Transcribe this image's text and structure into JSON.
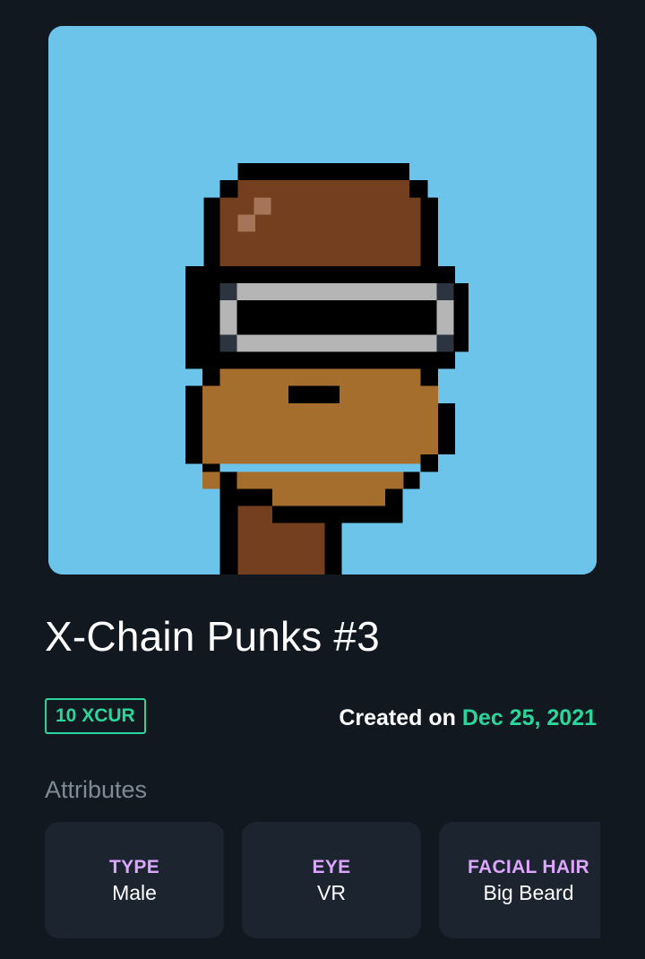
{
  "nft": {
    "title": "X-Chain Punks #3",
    "image_name": "pixel-punk-portrait"
  },
  "price": {
    "label": "10 XCUR"
  },
  "created": {
    "prefix": "Created on ",
    "date": "Dec 25, 2021"
  },
  "attributes": {
    "heading": "Attributes",
    "items": [
      {
        "key": "TYPE",
        "value": "Male"
      },
      {
        "key": "EYE",
        "value": "VR"
      },
      {
        "key": "FACIAL HAIR",
        "value": "Big Beard"
      }
    ]
  },
  "colors": {
    "background": "#111820",
    "accent": "#2bd69b",
    "attribute_key": "#dca6ff",
    "card": "#1c252f",
    "art_background": "#6dc4ea"
  }
}
